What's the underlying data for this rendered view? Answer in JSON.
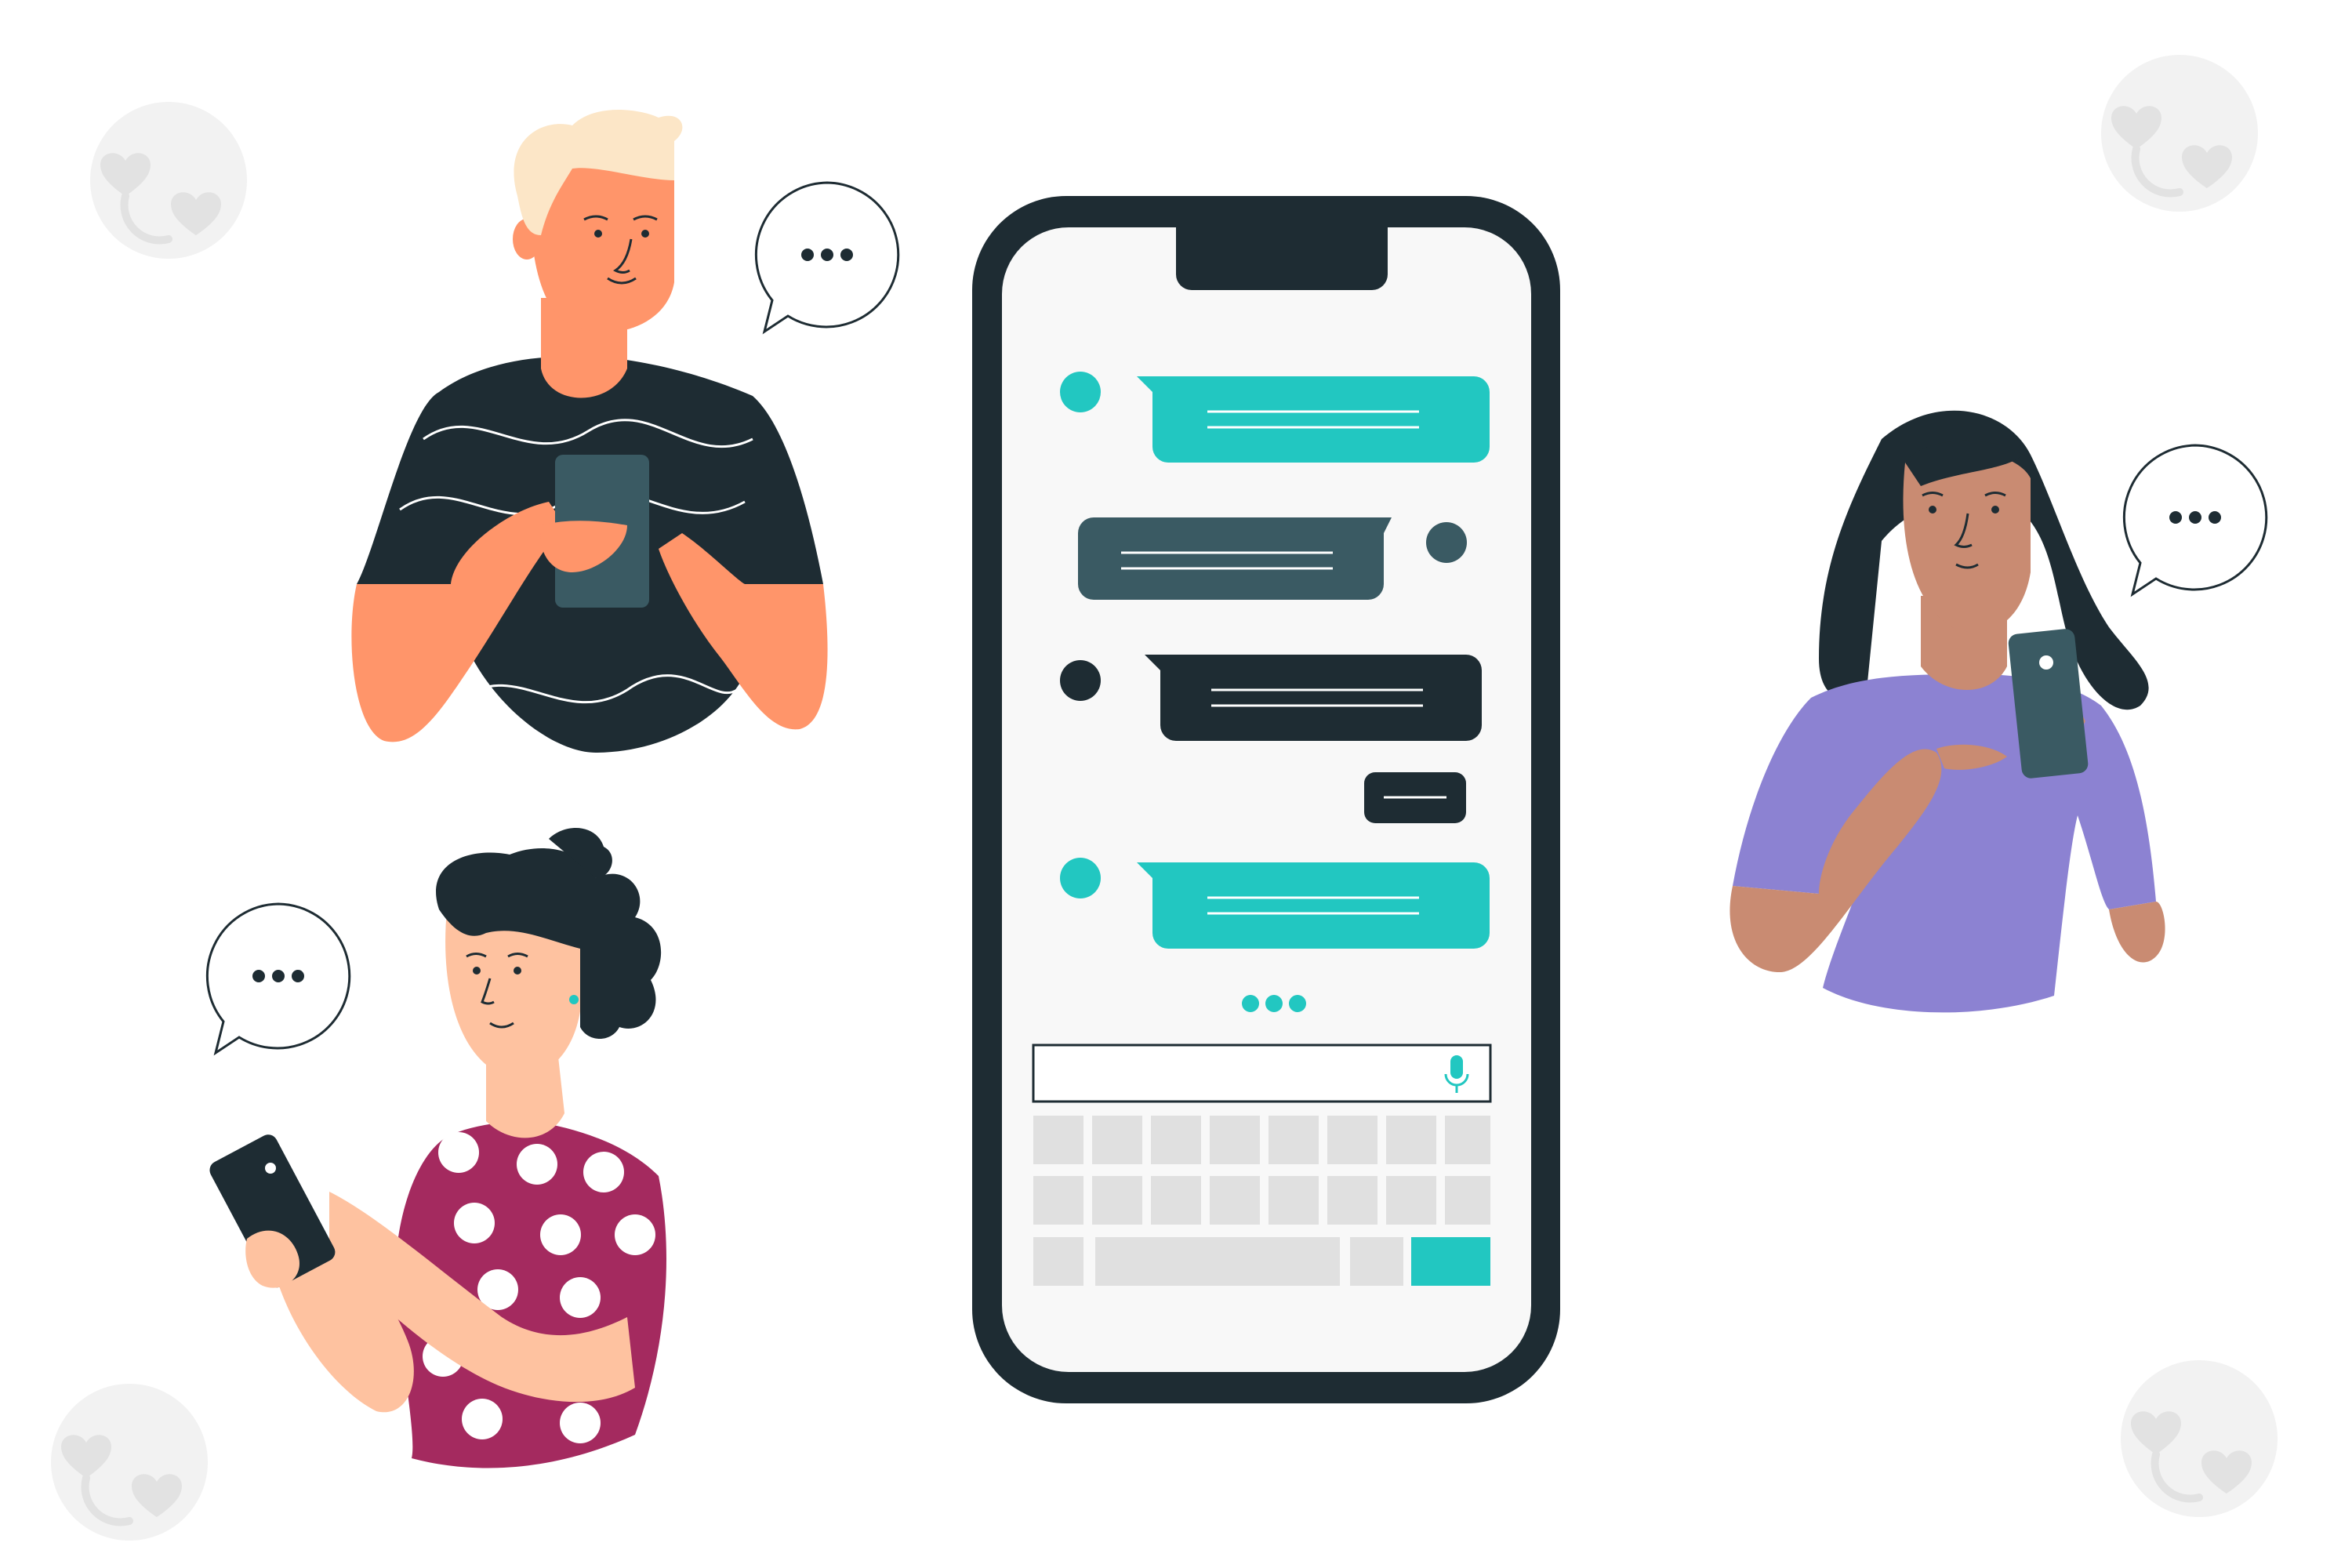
{
  "illustration": {
    "kind": "group-chat-illustration",
    "colors": {
      "teal": "#22C7C1",
      "dark": "#1E2C33",
      "slate": "#3A5A63",
      "skin_orange": "#FF956A",
      "hair_blond": "#FCE6C7",
      "purple": "#8C82D2",
      "skin_tan": "#C98B72",
      "maroon": "#A42A5F",
      "skin_light": "#FEC2A0",
      "key_gray": "#E0E0E0",
      "badge_gray": "#F2F2F2"
    },
    "icons": [
      "heart-face-badge-icon",
      "speech-bubble-icon",
      "microphone-icon",
      "typing-dots-icon"
    ],
    "typing_indicator": "..."
  },
  "phone": {
    "messages": [
      {
        "side": "left",
        "style": "teal"
      },
      {
        "side": "right",
        "style": "slate"
      },
      {
        "side": "left",
        "style": "dark"
      },
      {
        "side": "right",
        "style": "dark-small"
      },
      {
        "side": "left",
        "style": "teal"
      }
    ],
    "keyboard_rows": [
      8,
      8,
      4
    ]
  }
}
